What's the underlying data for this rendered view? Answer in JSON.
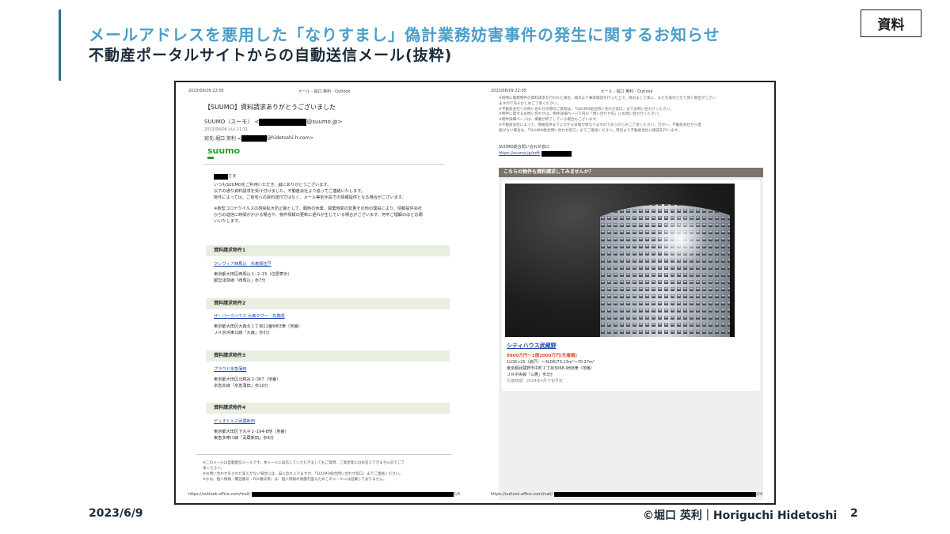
{
  "slide": {
    "title_main": "メールアドレスを悪用した「なりすまし」偽計業務妨害事件の発生に関するお知らせ",
    "subtitle": "不動産ポータルサイトからの自動送信メール(抜粋)",
    "badge": "資料",
    "date": "2023/6/9",
    "credit": "©堀口 英利｜Horiguchi Hidetoshi",
    "page_number": "2",
    "accent_color": "#4a9ec9"
  },
  "page_left": {
    "header_datetime": "2023/06/09 22:05",
    "header_center": "メール - 堀口 英利 - Outlook",
    "subject": "【SUUMO】資料請求ありがとうございました",
    "from_name": "SUUMO（スーモ） <",
    "from_domain": "@suumo.jp>",
    "sent_date": "2023/06/06 (火) 21:31",
    "to_prefix": "宛先:堀口 英利 <",
    "to_domain": "@hidetoshi-h.com>",
    "logo_text": "suumo",
    "greeting_suffix": "さま",
    "body_lines": [
      "いつもSUUMOをご利用いただき、誠にありがとうございます。",
      "以下の通り資料請求を受け付けました。不動産会社より追ってご連絡いたします。",
      "物件によっては、ご自宅への資料送付ではなく、メール等別手段での情報提供となる場合がございます。"
    ],
    "notice_lines": [
      "※新型コロナウイルスの感染拡大防止策として、臨時の休業、開業時間の変更その他の理由により、情報提供会社",
      "からの返信に時間がかかる場合や、物件情報の更新に遅れが生じている場合がございます。何卒ご理解のほどお願",
      "いいたします。"
    ],
    "properties": [
      {
        "heading": "資料請求物件1",
        "name": "クレヴィア西馬込　先着順住戸",
        "address": "東京都大田区西馬込１-２-15（住居表示）",
        "station": "都営浅草線「西馬込」歩7分"
      },
      {
        "heading": "資料請求物件2",
        "name": "ザ・パークハウス 大森タワー　先着順",
        "address": "東京都大田区大森北１丁目11番9他3筆（地番）",
        "station": "ＪＲ京浜東北線「大森」歩3分"
      },
      {
        "heading": "資料請求物件3",
        "name": "プラウド京急蒲田",
        "address": "東京都大田区北糀谷２-367（地番）",
        "station": "京急本線「京急蒲田」歩10分"
      },
      {
        "heading": "資料請求物件4",
        "name": "デュオヒルズ武蔵新田",
        "address": "東京都大田区下丸子２-194-8他（地番）",
        "station": "東急多摩川線「武蔵新田」歩8分"
      }
    ],
    "footer_notes": [
      "※このメールは自動配信メールです。本メールに返信していただきましてもご質問、ご意見等にはお答えできませんのでご了",
      "承ください。",
      "※お問い合わせをされた覚えがない場合には、誠に恐れ入りますが、「SUUMO総合問い合わせ窓口」までご連絡ください。",
      "※なお、個人情報（電話番号・FAX番号等）は、個人情報の保護を図るためこのメールには記載しておりません。"
    ],
    "footer_url": "https://outlook.office.com/mail/",
    "footer_page": "1/4"
  },
  "page_right": {
    "header_datetime": "2023/06/09 22:05",
    "header_center": "メール - 堀口 英利 - Outlook",
    "notes": [
      "※同時に複数物件の資料請求を行われた場合、順次より事実確認を行った上で、改めまして後に、またを送付させて頂く場合がござい",
      "ますのであらかじめご了承ください。",
      "※不動産会社への問い合わせの際のご質問は、「SUUMO総合問い合わせ窓口」までお問い合わせください。",
      "※物件に関するお問い合わせは、物件詳細ページ下内の「問い合わせ先」にお問い合わせください。",
      "※物件詳細ページは、掲載が終了している場合もございます。",
      "※不動産会社によって、情報提供までにかかる日数が異なりますのであらかじめご了承ください。万が一、不動産会社から連",
      "絡がない場合は、「SUUMO総合問い合わせ窓口」までご連絡ください。弊社より不動産会社に確認を行います。"
    ],
    "contact_label": "SUUMO総合問い合わせ窓口",
    "contact_url": "https://suumo.jp/edit",
    "recommend_heading": "こちらの物件も資料請求してみませんか？",
    "rec_name": "シティハウス武蔵野",
    "rec_price": "9900万円～1億2000万円(先着順)",
    "rec_layout": "1LDK+2S（納戸）～3LDK/70.13m²～70.27m²",
    "rec_address": "東京都武蔵野市中町１丁目3068-9他8筆（地番）",
    "rec_station": "ＪＲ中央線「三鷹」歩3分",
    "rec_delivery": "引渡時期：2024年4月下旬予定",
    "footer_url": "https://outlook.office.com/mail/",
    "footer_page": "2/4"
  }
}
